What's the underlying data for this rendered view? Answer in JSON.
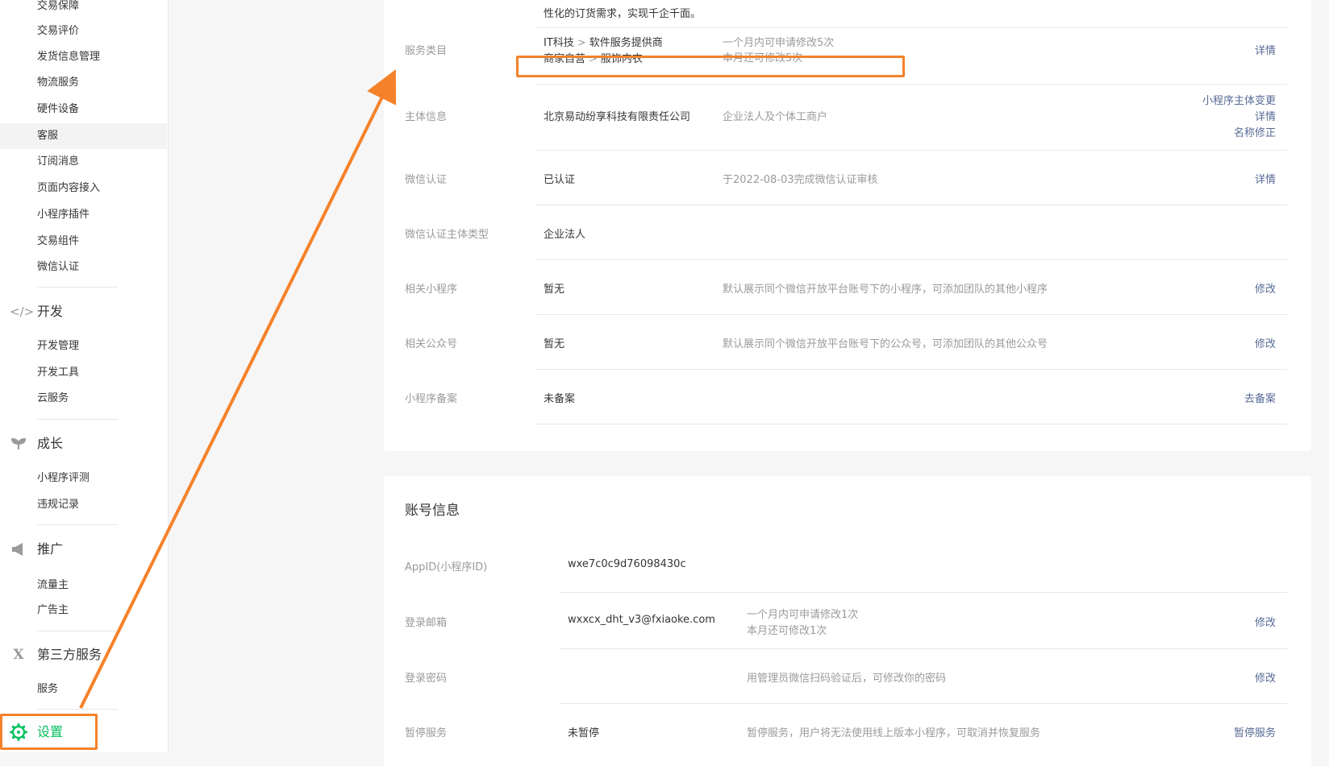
{
  "sidebar": {
    "items_top": [
      {
        "label": "交易保障"
      },
      {
        "label": "交易评价"
      },
      {
        "label": "发货信息管理"
      },
      {
        "label": "物流服务"
      },
      {
        "label": "硬件设备"
      },
      {
        "label": "客服"
      },
      {
        "label": "订阅消息"
      },
      {
        "label": "页面内容接入"
      },
      {
        "label": "小程序插件"
      },
      {
        "label": "交易组件"
      },
      {
        "label": "微信认证"
      }
    ],
    "groups": {
      "dev": {
        "label": "开发",
        "icon": "code-icon",
        "items": [
          {
            "label": "开发管理"
          },
          {
            "label": "开发工具"
          },
          {
            "label": "云服务"
          }
        ]
      },
      "growth": {
        "label": "成长",
        "icon": "sprout-icon",
        "items": [
          {
            "label": "小程序评测"
          },
          {
            "label": "违规记录"
          }
        ]
      },
      "promo": {
        "label": "推广",
        "icon": "megaphone-icon",
        "items": [
          {
            "label": "流量主"
          },
          {
            "label": "广告主"
          }
        ]
      },
      "third": {
        "label": "第三方服务",
        "icon": "third-party-icon",
        "items": [
          {
            "label": "服务"
          }
        ]
      },
      "settings": {
        "label": "设置",
        "icon": "gear-icon"
      }
    }
  },
  "basic_info": {
    "top_text": "性化的订货需求，实现千企千面。",
    "service_category": {
      "label": "服务类目",
      "cat1_a": "IT科技",
      "cat1_b": "软件服务提供商",
      "cat2_a": "商家自营",
      "cat2_b": "服饰内衣",
      "desc1": "一个月内可申请修改5次",
      "desc2": "本月还可修改5次",
      "action": "详情"
    },
    "subject": {
      "label": "主体信息",
      "value": "北京易动纷享科技有限责任公司",
      "desc": "企业法人及个体工商户",
      "action1": "小程序主体变更",
      "action2": "详情",
      "action3": "名称修正"
    },
    "wechat_cert": {
      "label": "微信认证",
      "value": "已认证",
      "desc": "于2022-08-03完成微信认证审核",
      "action": "详情"
    },
    "cert_type": {
      "label": "微信认证主体类型",
      "value": "企业法人"
    },
    "related_mp": {
      "label": "相关小程序",
      "value": "暂无",
      "desc": "默认展示同个微信开放平台账号下的小程序，可添加团队的其他小程序",
      "action": "修改"
    },
    "related_oa": {
      "label": "相关公众号",
      "value": "暂无",
      "desc": "默认展示同个微信开放平台账号下的公众号，可添加团队的其他公众号",
      "action": "修改"
    },
    "filing": {
      "label": "小程序备案",
      "value": "未备案",
      "action": "去备案"
    }
  },
  "account_info": {
    "title": "账号信息",
    "appid": {
      "label": "AppID(小程序ID)",
      "value": "wxe7c0c9d76098430c"
    },
    "email": {
      "label": "登录邮箱",
      "value": "wxxcx_dht_v3@fxiaoke.com",
      "desc1": "一个月内可申请修改1次",
      "desc2": "本月还可修改1次",
      "action": "修改"
    },
    "password": {
      "label": "登录密码",
      "desc": "用管理员微信扫码验证后，可修改你的密码",
      "action": "修改"
    },
    "pause": {
      "label": "暂停服务",
      "value": "未暂停",
      "desc": "暂停服务，用户将无法使用线上版本小程序，可取消并恢复服务",
      "action": "暂停服务"
    }
  },
  "colors": {
    "accent_green": "#07c160",
    "link_blue": "#576b95",
    "annotation_orange": "#f5822a"
  }
}
